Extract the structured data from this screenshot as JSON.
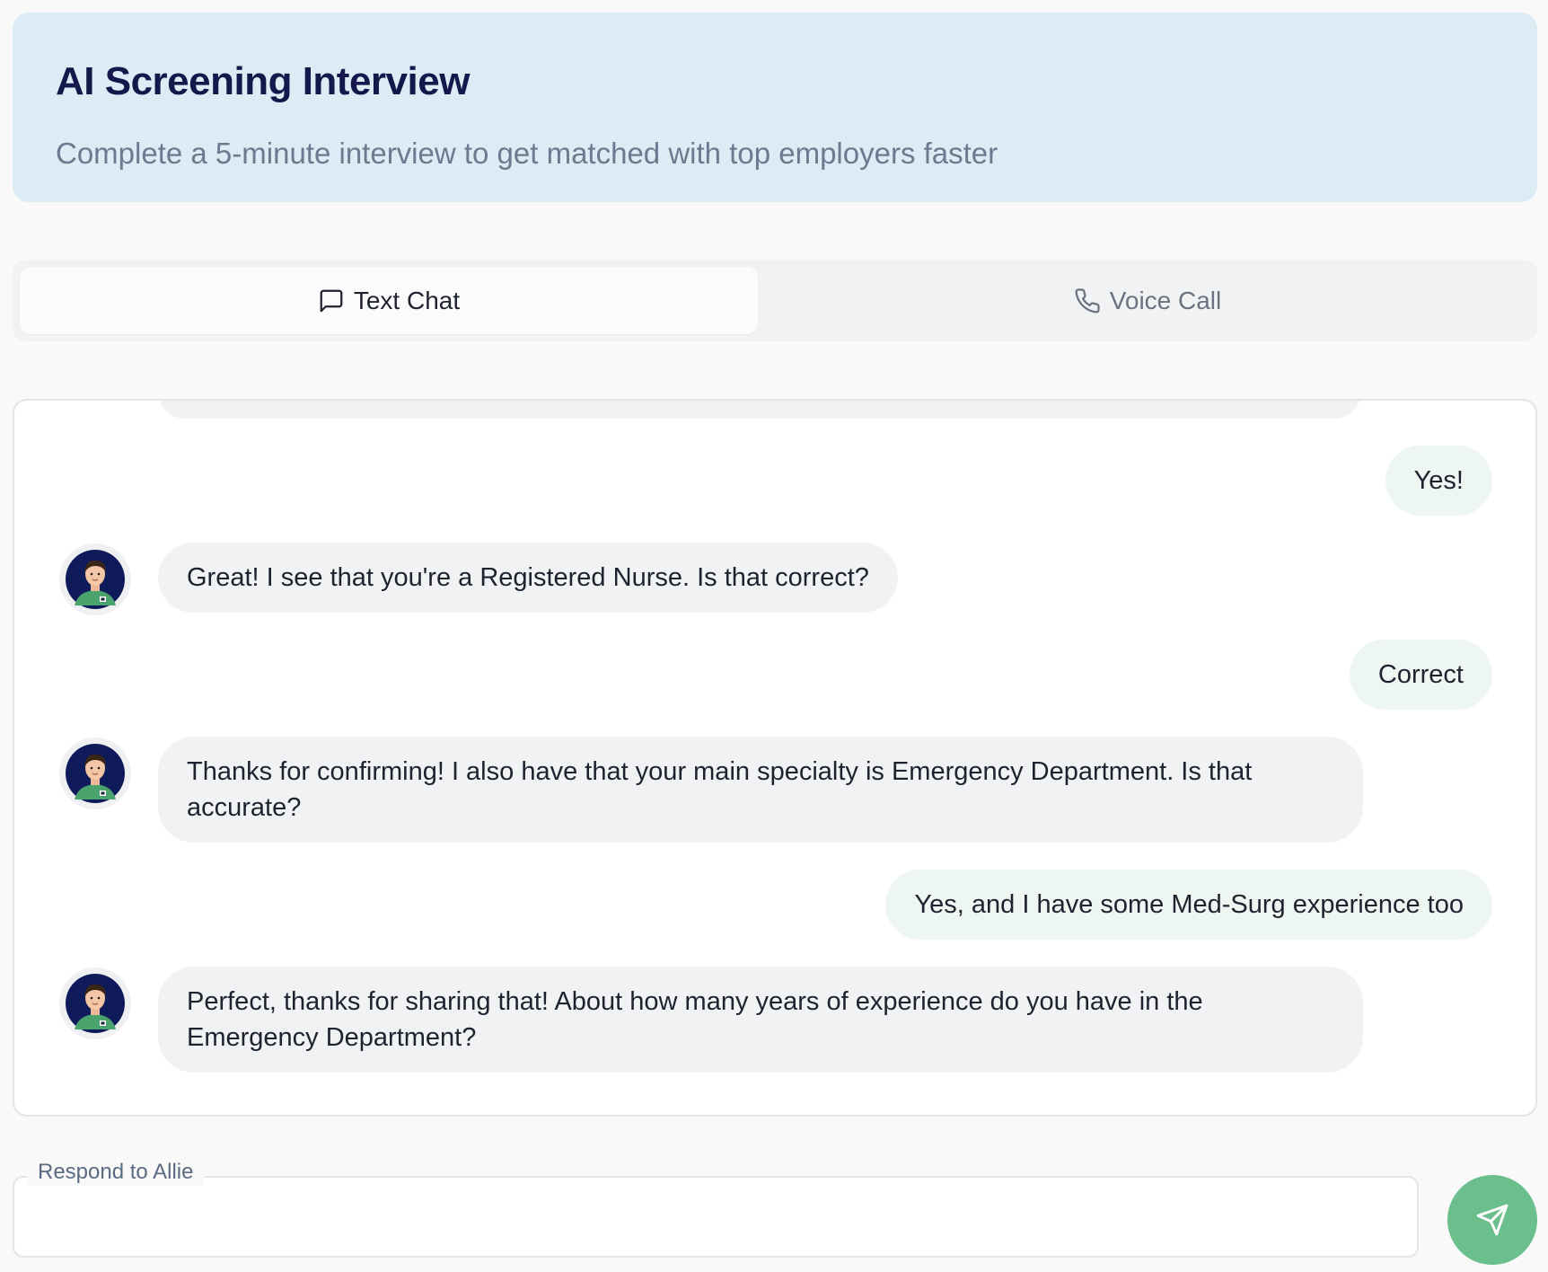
{
  "header": {
    "title": "AI Screening Interview",
    "subtitle": "Complete a 5-minute interview to get matched with top employers faster"
  },
  "tabs": [
    {
      "label": "Text Chat",
      "icon": "message-square-icon",
      "active": true
    },
    {
      "label": "Voice Call",
      "icon": "phone-icon",
      "active": false
    }
  ],
  "messages": [
    {
      "sender": "user",
      "text": "Yes!"
    },
    {
      "sender": "ai",
      "text": "Great! I see that you're a Registered Nurse. Is that correct?"
    },
    {
      "sender": "user",
      "text": "Correct"
    },
    {
      "sender": "ai",
      "text": "Thanks for confirming! I also have that your main specialty is Emergency Department. Is that accurate?"
    },
    {
      "sender": "user",
      "text": "Yes, and I have some Med-Surg experience too"
    },
    {
      "sender": "ai",
      "text": "Perfect, thanks for sharing that! About how many years of experience do you have in the Emergency Department?"
    }
  ],
  "input": {
    "label": "Respond to Allie",
    "value": "",
    "placeholder": ""
  },
  "send_button": {
    "icon": "send-icon"
  },
  "colors": {
    "header_bg": "#dcecf5",
    "title": "#14184a",
    "ai_bubble": "#f1f2f4",
    "user_bubble": "#eef6f1",
    "send_button": "#6abf8c"
  }
}
